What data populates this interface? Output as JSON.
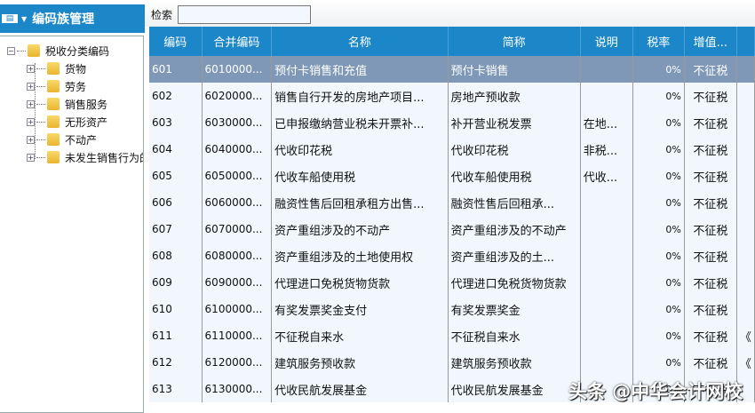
{
  "left_panel": {
    "title": "编码族管理",
    "menu_icon_label": "管理",
    "tree": {
      "root": "税收分类编码",
      "children": [
        "货物",
        "劳务",
        "销售服务",
        "无形资产",
        "不动产",
        "未发生销售行为的"
      ]
    }
  },
  "search": {
    "label": "检索",
    "value": ""
  },
  "table": {
    "columns": [
      "编码",
      "合并编码",
      "名称",
      "简称",
      "说明",
      "税率",
      "增值...",
      ""
    ],
    "rows": [
      [
        "601",
        "6010000...",
        "预付卡销售和充值",
        "预付卡销售",
        "",
        "0%",
        "不征税",
        ""
      ],
      [
        "602",
        "6020000...",
        "销售自行开发的房地产项目...",
        "房地产预收款",
        "",
        "0%",
        "不征税",
        ""
      ],
      [
        "603",
        "6030000...",
        "已申报缴纳营业税未开票补...",
        "补开营业税发票",
        "在地...",
        "0%",
        "不征税",
        ""
      ],
      [
        "604",
        "6040000...",
        "代收印花税",
        "代收印花税",
        "非税...",
        "0%",
        "不征税",
        ""
      ],
      [
        "605",
        "6050000...",
        "代收车船使用税",
        "代收车船使用税",
        "代收...",
        "0%",
        "不征税",
        ""
      ],
      [
        "606",
        "6060000...",
        "融资性售后回租承租方出售...",
        "融资性售后回租承...",
        "",
        "0%",
        "不征税",
        ""
      ],
      [
        "607",
        "6070000...",
        "资产重组涉及的不动产",
        "资产重组涉及的不动产",
        "",
        "0%",
        "不征税",
        ""
      ],
      [
        "608",
        "6080000...",
        "资产重组涉及的土地使用权",
        "资产重组涉及的土...",
        "",
        "0%",
        "不征税",
        ""
      ],
      [
        "609",
        "6090000...",
        "代理进口免税货物货款",
        "代理进口免税货物货款",
        "",
        "0%",
        "不征税",
        ""
      ],
      [
        "610",
        "6100000...",
        "有奖发票奖金支付",
        "有奖发票奖金",
        "",
        "0%",
        "不征税",
        ""
      ],
      [
        "611",
        "6110000...",
        "不征税自来水",
        "不征税自来水",
        "",
        "0%",
        "不征税",
        "《"
      ],
      [
        "612",
        "6120000...",
        "建筑服务预收款",
        "建筑服务预收款",
        "",
        "0%",
        "不征税",
        "《"
      ],
      [
        "613",
        "6130000...",
        "代收民航发展基金",
        "代收民航发展基金",
        "",
        "0%",
        "不征税",
        ""
      ]
    ],
    "selected_row": 0
  },
  "watermark": "头条 @中华会计网校"
}
